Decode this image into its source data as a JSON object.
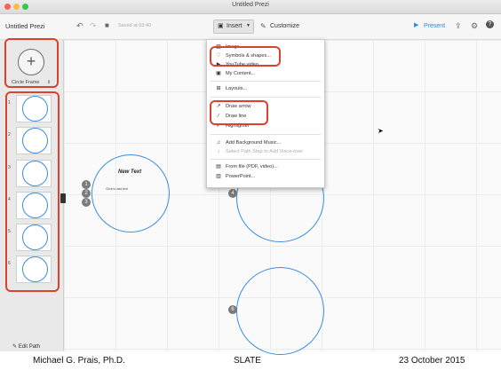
{
  "window": {
    "title": "Untitled Prezi"
  },
  "toolbar": {
    "doc_name": "Untitled Prezi",
    "saved_text": "Saved at 03:40",
    "insert_label": "Insert",
    "customize_label": "Customize",
    "present_label": "Present"
  },
  "sidebar": {
    "frame_type": "Circle Frame",
    "slides": [
      "1",
      "2",
      "3",
      "4",
      "5",
      "6"
    ],
    "edit_path_label": "Edit Path"
  },
  "canvas": {
    "frame_text_title": "New Text",
    "frame_text_body": "Click to add text",
    "frame_numbers": [
      "1",
      "2",
      "3",
      "4",
      "6"
    ]
  },
  "insert_menu": {
    "items": [
      {
        "label": "Image...",
        "icon": "image-icon"
      },
      {
        "label": "Symbols & shapes...",
        "icon": "symbols-icon"
      },
      {
        "label": "YouTube video...",
        "icon": "youtube-icon"
      },
      {
        "label": "My Content...",
        "icon": "content-icon"
      },
      {
        "label": "Layouts...",
        "icon": "layouts-icon"
      },
      {
        "label": "Draw arrow",
        "icon": "arrow-icon"
      },
      {
        "label": "Draw line",
        "icon": "line-icon"
      },
      {
        "label": "Highlighter",
        "icon": "highlighter-icon"
      },
      {
        "label": "Add Background Music...",
        "icon": "music-icon"
      },
      {
        "label": "Select Path Step to Add Voice-over",
        "icon": "voice-icon"
      },
      {
        "label": "From file (PDF, video)...",
        "icon": "file-icon"
      },
      {
        "label": "PowerPoint...",
        "icon": "powerpoint-icon"
      }
    ]
  },
  "footer": {
    "author": "Michael G. Prais, Ph.D.",
    "center": "SLATE",
    "date": "23 October 2015"
  },
  "colors": {
    "accent": "#3a8ee6",
    "highlight": "#d9432c",
    "present": "#2f86e8"
  }
}
